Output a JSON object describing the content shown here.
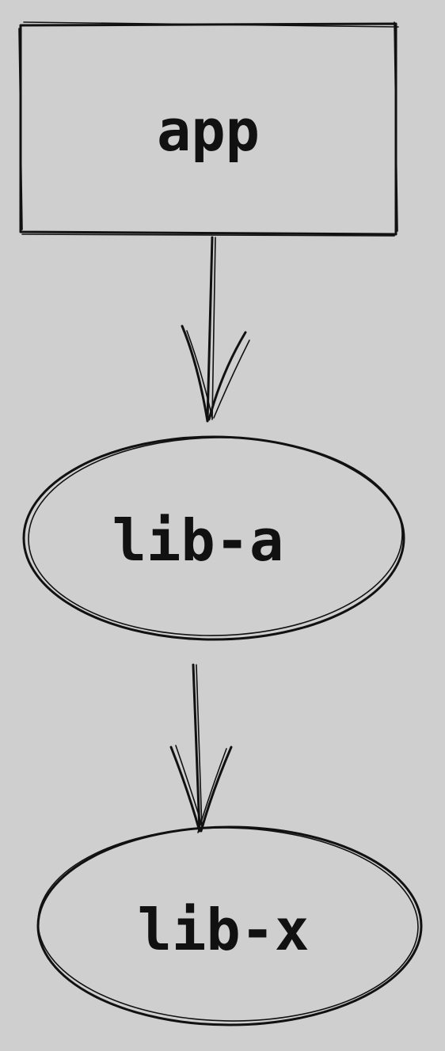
{
  "nodes": [
    {
      "id": "app",
      "label": "app",
      "shape": "rectangle"
    },
    {
      "id": "lib-a",
      "label": "lib-a",
      "shape": "ellipse"
    },
    {
      "id": "lib-x",
      "label": "lib-x",
      "shape": "ellipse"
    }
  ],
  "edges": [
    {
      "from": "app",
      "to": "lib-a"
    },
    {
      "from": "lib-a",
      "to": "lib-x"
    }
  ],
  "colors": {
    "background": "#cfcfcf",
    "stroke": "#111111"
  }
}
